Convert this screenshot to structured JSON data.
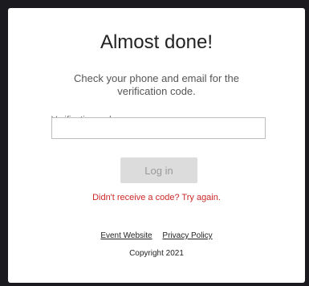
{
  "page": {
    "title": "Almost done!",
    "subtitle": "Check your phone and email for the verification code."
  },
  "form": {
    "code_label": "Verification code",
    "code_value": "",
    "code_placeholder": "",
    "login_label": "Log in",
    "resend_text": "Didn't receive a code? Try again."
  },
  "footer": {
    "event_website": "Event Website",
    "privacy_policy": "Privacy Policy",
    "copyright": "Copyright 2021"
  },
  "colors": {
    "error_red": "#cc2727",
    "button_disabled_bg": "#dcdcdc",
    "button_disabled_text": "#9a9a9a"
  }
}
